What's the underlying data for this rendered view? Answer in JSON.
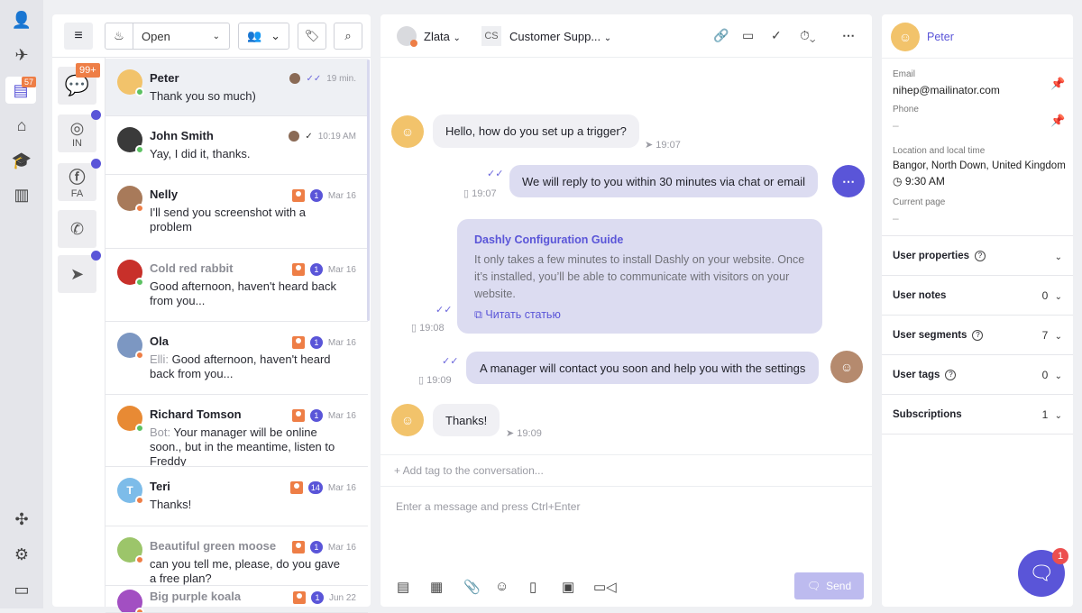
{
  "nav": {
    "items": [
      {
        "icon": "users-icon"
      },
      {
        "icon": "rocket-icon"
      },
      {
        "icon": "chats-icon",
        "badge": "57"
      },
      {
        "icon": "bot-icon"
      },
      {
        "icon": "academy-icon"
      },
      {
        "icon": "reports-icon"
      }
    ],
    "bottom": [
      {
        "icon": "puzzle-icon"
      },
      {
        "icon": "settings-icon"
      },
      {
        "icon": "billing-icon"
      }
    ]
  },
  "toolbar": {
    "status": "Open"
  },
  "channels": [
    {
      "icon": "chat-bubbles-icon",
      "badge": "99+"
    },
    {
      "icon": "instagram-icon",
      "label": "IN"
    },
    {
      "icon": "facebook-icon",
      "label": "FA"
    },
    {
      "icon": "whatsapp-icon"
    },
    {
      "icon": "telegram-icon"
    }
  ],
  "conversations": [
    {
      "name": "Peter",
      "preview": "Thank you so much)",
      "time": "19 min.",
      "status": "online",
      "color": "#f2c36b"
    },
    {
      "name": "John Smith",
      "preview": "Yay, I did it, thanks.",
      "time": "10:19 AM",
      "status": "online",
      "color": "#3a3a3a"
    },
    {
      "name": "Nelly",
      "preview": "I'll send you screenshot with a problem",
      "time": "Mar 16",
      "count": "1",
      "status": "away",
      "color": "#a87a5a"
    },
    {
      "name": "Cold red rabbit",
      "preview": "Good afternoon, haven't heard back from you...",
      "time": "Mar 16",
      "count": "1",
      "status": "online",
      "color": "#c8302a"
    },
    {
      "name": "Ola",
      "prefix": "Elli:",
      "preview": "Good afternoon, haven't heard back from you...",
      "time": "Mar 16",
      "count": "1",
      "status": "away",
      "color": "#7c97c2"
    },
    {
      "name": "Richard Tomson",
      "prefix": "Bot:",
      "preview": "Your manager will be online soon., but in the meantime, listen to Freddy",
      "time": "Mar 16",
      "count": "1",
      "status": "online",
      "color": "#e88a34"
    },
    {
      "name": "Teri",
      "initial": "T",
      "preview": "Thanks!",
      "time": "Mar 16",
      "count": "14",
      "status": "away",
      "color": "#7dbce9"
    },
    {
      "name": "Beautiful green moose",
      "preview": "can you tell me, please, do you gave a free plan?",
      "time": "Mar 16",
      "count": "1",
      "status": "away",
      "color": "#9cc56a"
    },
    {
      "name": "Big purple koala",
      "preview": "",
      "time": "Jun 22",
      "count": "1",
      "status": "away",
      "color": "#a24fc2"
    }
  ],
  "chat": {
    "assignee": "Zlata",
    "team_initials": "CS",
    "team": "Customer Supp...",
    "messages": [
      {
        "from": "user",
        "text": "Hello, how do you set up a trigger?",
        "time": "19:07"
      },
      {
        "from": "bot",
        "text": "We will reply to you within 30 minutes via chat or email",
        "time": "19:07"
      },
      {
        "from": "operator",
        "title": "Dashly Configuration Guide",
        "text": "It only takes a few minutes to install Dashly on your website. Once it’s installed, you’ll be able to communicate with visitors on your website.",
        "link": "Читать статью",
        "time": "19:08"
      },
      {
        "from": "operator",
        "text": "A manager will contact you soon and help you with the settings",
        "time": "19:09"
      },
      {
        "from": "user",
        "text": "Thanks!",
        "time": "19:09"
      }
    ],
    "tag_placeholder": "+ Add tag to the conversation...",
    "input_placeholder": "Enter a message and press Ctrl+Enter",
    "send": "Send"
  },
  "user": {
    "name": "Peter",
    "email_label": "Email",
    "email": "nihep@mailinator.com",
    "phone_label": "Phone",
    "phone": "–",
    "location_label": "Location and local time",
    "location": "Bangor, North Down, United Kingdom",
    "local_time": "9:30 AM",
    "page_label": "Current page",
    "page": "–",
    "sections": [
      {
        "label": "User properties",
        "help": true,
        "count": ""
      },
      {
        "label": "User notes",
        "count": "0"
      },
      {
        "label": "User segments",
        "help": true,
        "count": "7"
      },
      {
        "label": "User tags",
        "help": true,
        "count": "0"
      },
      {
        "label": "Subscriptions",
        "count": "1"
      }
    ]
  },
  "widget": {
    "badge": "1"
  },
  "colors": {
    "accent": "#5a55d8",
    "orange": "#ee7e46",
    "online": "#5cc162"
  }
}
